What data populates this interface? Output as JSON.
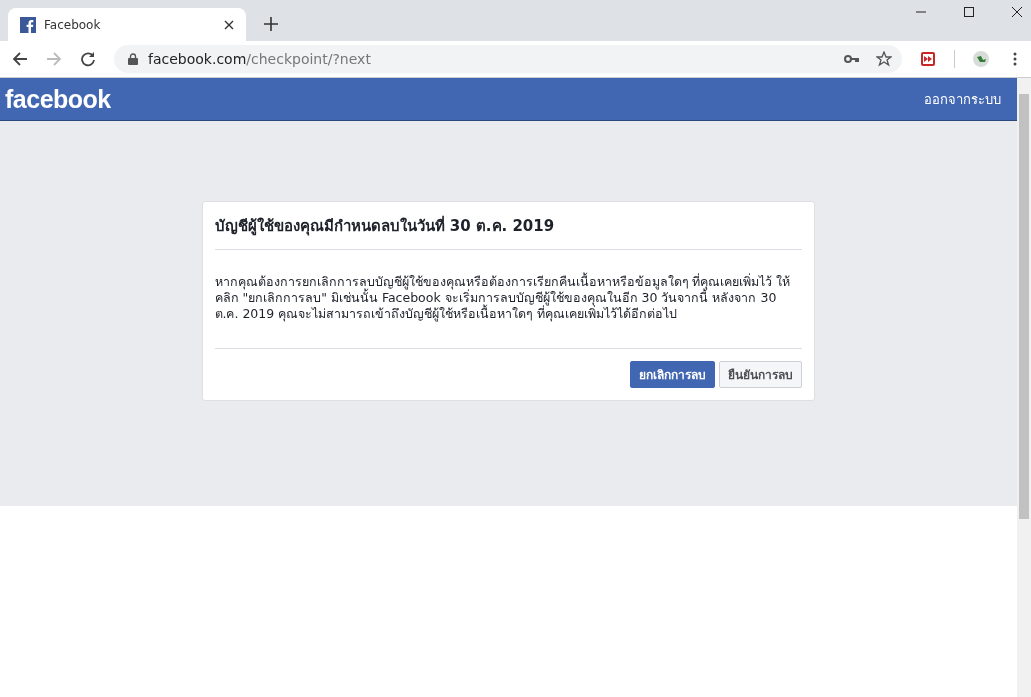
{
  "browser": {
    "tab": {
      "title": "Facebook",
      "selected": true
    },
    "address": {
      "host": "facebook.com",
      "path": "/checkpoint/?next"
    }
  },
  "header": {
    "logo": "facebook",
    "logout": "ออกจากระบบ"
  },
  "dialog": {
    "title": "บัญชีผู้ใช้ของคุณมีกำหนดลบในวันที่ 30 ต.ค. 2019",
    "body": "หากคุณต้องการยกเลิกการลบบัญชีผู้ใช้ของคุณหรือต้องการเรียกคืนเนื้อหาหรือข้อมูลใดๆ ที่คุณเคยเพิ่มไว้ ให้คลิก \"ยกเลิกการลบ\" มิเช่นนั้น Facebook จะเริ่มการลบบัญชีผู้ใช้ของคุณในอีก 30 วันจากนี้ หลังจาก 30 ต.ค. 2019 คุณจะไม่สามารถเข้าถึงบัญชีผู้ใช้หรือเนื้อหาใดๆ ที่คุณเคยเพิ่มไว้ได้อีกต่อไป",
    "buttons": [
      {
        "label": "ยกเลิกการลบ",
        "kind": "primary"
      },
      {
        "label": "ยืนยันการลบ",
        "kind": "secondary"
      }
    ]
  }
}
